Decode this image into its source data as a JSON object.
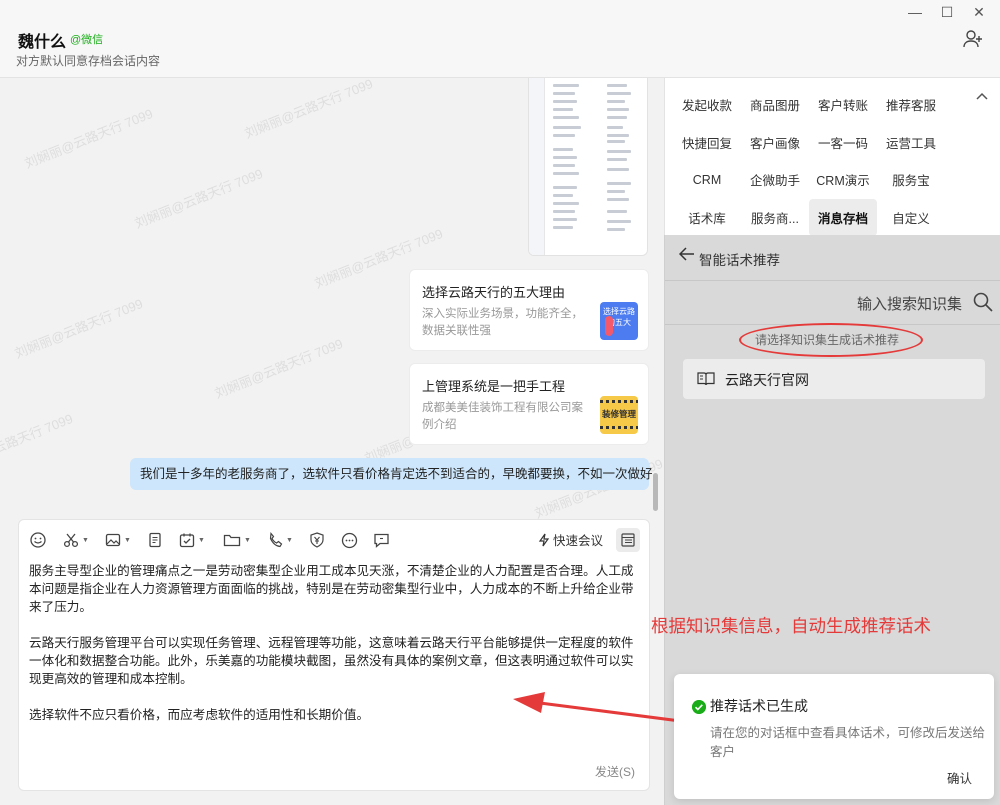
{
  "window": {
    "minimize": "—",
    "maximize": "☐",
    "close": "✕"
  },
  "header": {
    "contact_name": "魏什么",
    "contact_platform": "@微信",
    "subtitle": "对方默认同意存档会话内容"
  },
  "watermark_text": "刘娴丽@云路天行 7099",
  "chat": {
    "cards": [
      {
        "title": "选择云路天行的五大理由",
        "desc": "深入实际业务场景，功能齐全，数据关联性强",
        "thumb_text": "选择云路的五大"
      },
      {
        "title": "上管理系统是一把手工程",
        "desc": "成都美美佳装饰工程有限公司案例介绍",
        "thumb_text": "装修管理"
      }
    ],
    "bubble": "我们是十多年的老服务商了，选软件只看价格肯定选不到适合的，早晚都要换，不如一次做好"
  },
  "editor": {
    "quick_meeting": "快速会议",
    "paragraphs": [
      "服务主导型企业的管理痛点之一是劳动密集型企业用工成本见天涨，不清楚企业的人力配置是否合理。人工成本问题是指企业在人力资源管理方面面临的挑战，特别是在劳动密集型行业中，人力成本的不断上升给企业带来了压力。",
      "云路天行服务管理平台可以实现任务管理、远程管理等功能，这意味着云路天行平台能够提供一定程度的软件一体化和数据整合功能。此外，乐美嘉的功能模块截图，虽然没有具体的案例文章，但这表明通过软件可以实现更高效的管理和成本控制。",
      "选择软件不应只看价格，而应考虑软件的适用性和长期价值。"
    ],
    "send": "发送(S)"
  },
  "panel": {
    "grid": [
      "发起收款",
      "商品图册",
      "客户转账",
      "推荐客服",
      "快捷回复",
      "客户画像",
      "一客一码",
      "运营工具",
      "CRM",
      "企微助手",
      "CRM演示",
      "服务宝",
      "话术库",
      "服务商...",
      "消息存档",
      "自定义"
    ],
    "selected": "消息存档"
  },
  "overlay": {
    "title": "智能话术推荐",
    "search_placeholder": "输入搜索知识集",
    "hint": "请选择知识集生成话术推荐",
    "kb_item": "云路天行官网"
  },
  "annotation": "根据知识集信息，自动生成推荐话术",
  "toast": {
    "title": "推荐话术已生成",
    "message": "请在您的对话框中查看具体话术，可修改后发送给客户",
    "confirm": "确认"
  },
  "colors": {
    "accent_red": "#e53a3a",
    "bubble_blue": "#cde6fb",
    "success_green": "#1aad19"
  },
  "icons": [
    "add-user-icon",
    "smile-icon",
    "scissors-icon",
    "image-icon",
    "document-icon",
    "task-icon",
    "folder-icon",
    "phone-icon",
    "yuan-shield-icon",
    "more-icon",
    "chat-icon",
    "lightning-icon",
    "format-icon",
    "back-arrow-icon",
    "search-icon",
    "book-icon",
    "check-circle-icon"
  ]
}
